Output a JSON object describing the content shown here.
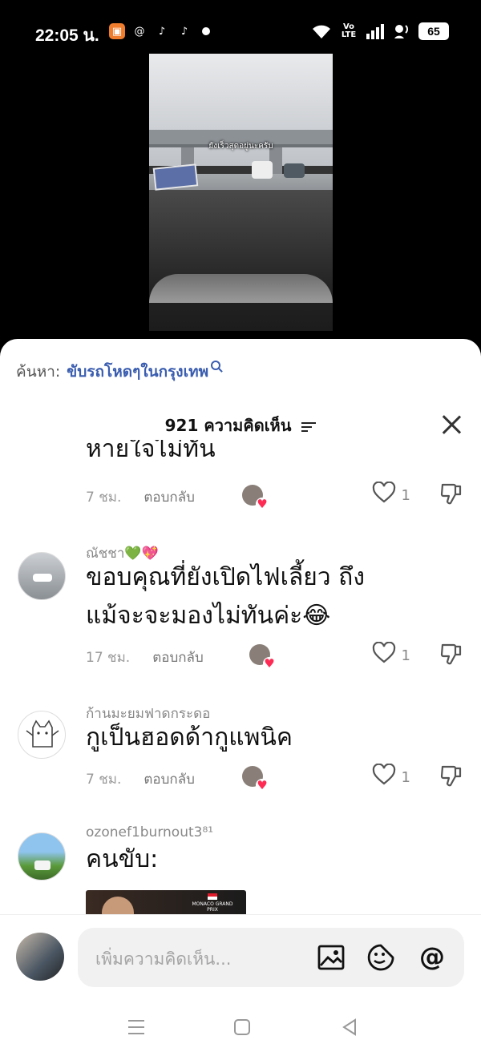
{
  "status_bar": {
    "time": "22:05 น.",
    "volte": "Vo LTE",
    "battery": "65"
  },
  "video": {
    "caption": "ยังเร็วสุดอยู่นะครับ"
  },
  "search": {
    "prefix": "ค้นหา:",
    "keyword": "ขับรถโหดๆในกรุงเทพ"
  },
  "header": {
    "comment_count_title": "921 ความคิดเห็น"
  },
  "comments": {
    "cut_off": {
      "text": "หายใจไม่ทัน",
      "time": "7 ชม.",
      "reply": "ตอบกลับ",
      "likes": "1"
    },
    "items": [
      {
        "username": "ณัชชา💚💖",
        "text_line1": "ขอบคุณที่ยังเปิดไฟเลี้ยว ถึง",
        "text_line2": "แม้จะจะมองไม่ทันค่ะ😂",
        "time": "17 ชม.",
        "reply": "ตอบกลับ",
        "likes": "1"
      },
      {
        "username": "ก้านมะยมฟาดกระดอ",
        "text_line1": "กูเป็นฮอดด้ากูแพนิค",
        "time": "7 ชม.",
        "reply": "ตอบกลับ",
        "likes": "1"
      },
      {
        "username": "ozonef1burnout3⁸¹",
        "text_line1": "คนขับ:",
        "image_text": "MONACO GRAND PRIX"
      }
    ]
  },
  "input": {
    "placeholder": "เพิ่มความคิดเห็น..."
  },
  "colors": {
    "accent_link": "#3a5db0",
    "like_heart": "#fe2c55"
  }
}
